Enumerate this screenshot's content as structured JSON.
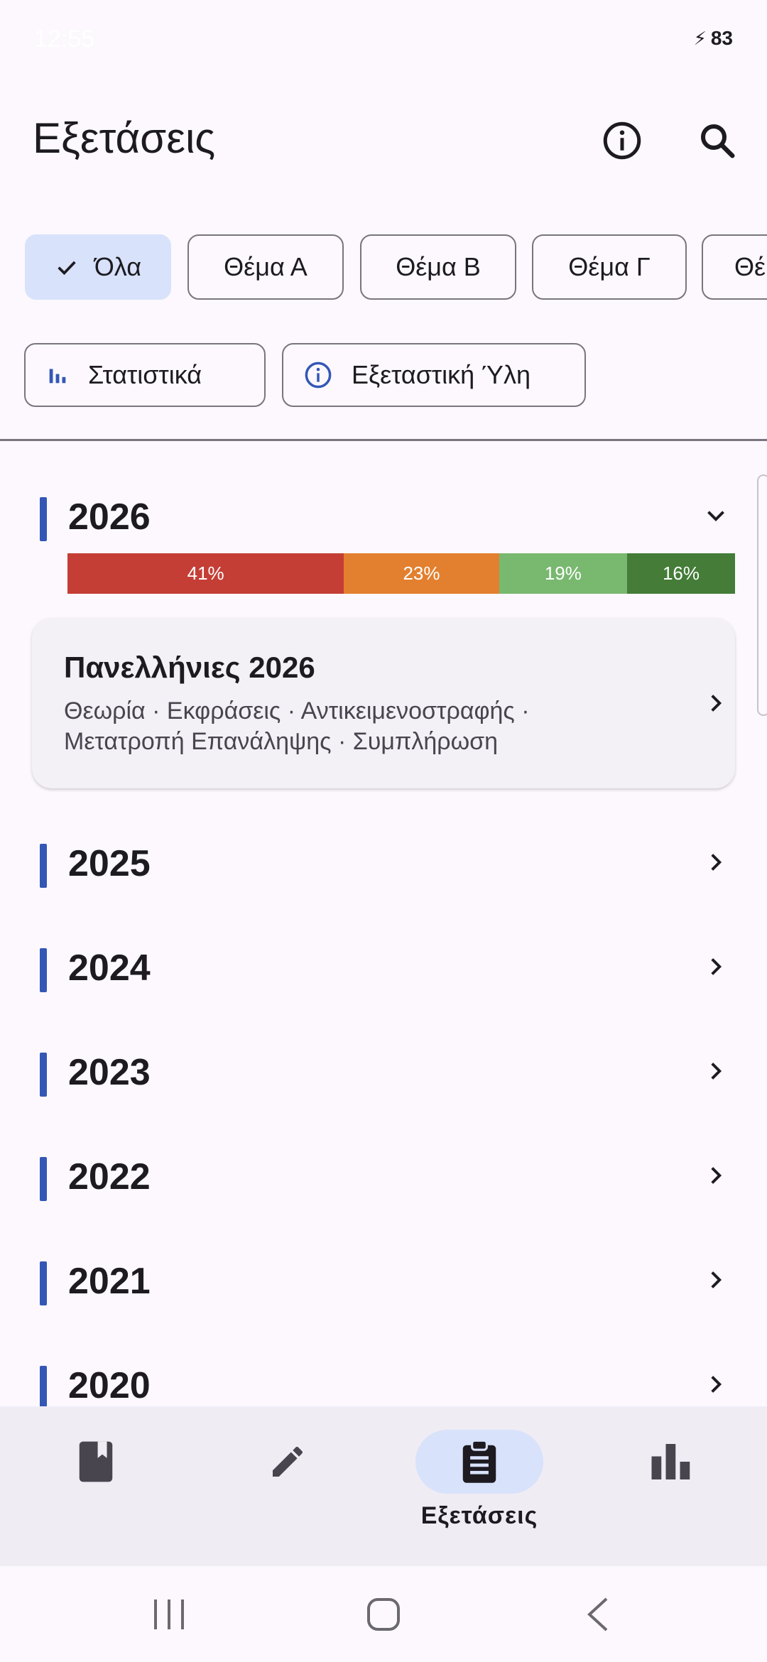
{
  "status_bar": {
    "time": "12:55",
    "battery": "83"
  },
  "app_bar": {
    "title": "Εξετάσεις"
  },
  "filters": {
    "chips": [
      {
        "label": "Όλα",
        "selected": true
      },
      {
        "label": "Θέμα Α",
        "selected": false
      },
      {
        "label": "Θέμα Β",
        "selected": false
      },
      {
        "label": "Θέμα Γ",
        "selected": false
      },
      {
        "label": "Θέμα Δ",
        "selected": false
      }
    ]
  },
  "actions": {
    "stats_label": "Στατιστικά",
    "syllabus_label": "Εξεταστική Ύλη"
  },
  "years": {
    "expanded": {
      "year": "2026",
      "distribution": [
        {
          "label": "41%",
          "value": 41,
          "color": "#c43e36"
        },
        {
          "label": "23%",
          "value": 23,
          "color": "#e2802f"
        },
        {
          "label": "19%",
          "value": 19,
          "color": "#78b86f"
        },
        {
          "label": "16%",
          "value": 16,
          "color": "#447c38"
        }
      ],
      "exam": {
        "title": "Πανελλήνιες 2026",
        "topics": "Θεωρία · Εκφράσεις · Αντικειμενοστραφής · Μετατροπή Επανάληψης · Συμπλήρωση"
      }
    },
    "collapsed": [
      "2025",
      "2024",
      "2023",
      "2022",
      "2021",
      "2020"
    ]
  },
  "bottom_nav": {
    "items": [
      {
        "icon": "book-icon",
        "label": ""
      },
      {
        "icon": "pencil-icon",
        "label": ""
      },
      {
        "icon": "clipboard-icon",
        "label": "Εξετάσεις",
        "active": true
      },
      {
        "icon": "bar-chart-icon",
        "label": ""
      }
    ]
  },
  "colors": {
    "accent": "#3457b6",
    "chip_selected": "#d8e2fb",
    "background": "#fcf8fd"
  }
}
